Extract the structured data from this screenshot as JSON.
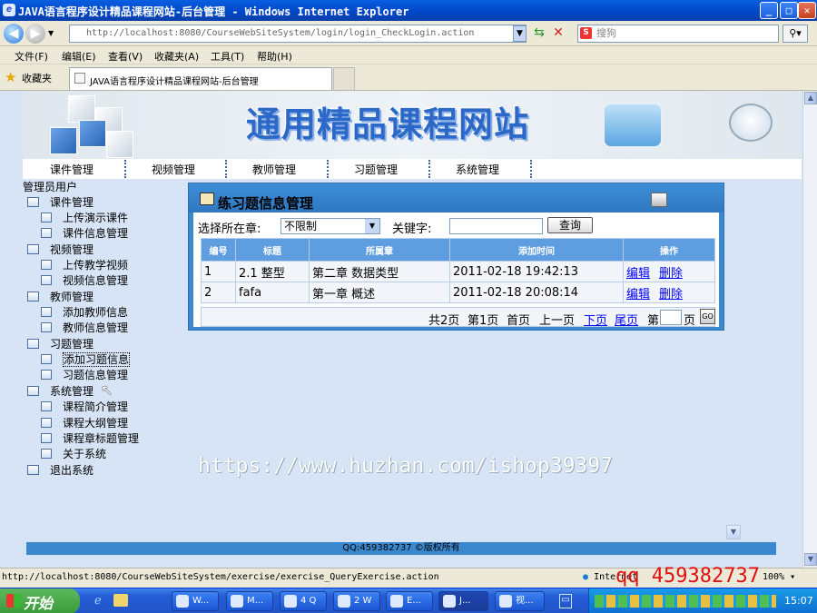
{
  "window": {
    "title": "JAVA语言程序设计精品课程网站-后台管理 - Windows Internet Explorer",
    "icon": "ie-icon",
    "address": "http://localhost:8080/CourseWebSiteSystem/login/login_CheckLogin.action",
    "search_placeholder": "搜狗"
  },
  "menu": [
    "文件(F)",
    "编辑(E)",
    "查看(V)",
    "收藏夹(A)",
    "工具(T)",
    "帮助(H)"
  ],
  "favorites": {
    "label": "收藏夹",
    "tab_title": "JAVA语言程序设计精品课程网站-后台管理"
  },
  "banner": {
    "title": "通用精品课程网站"
  },
  "nav": [
    "课件管理",
    "视频管理",
    "教师管理",
    "习题管理",
    "系统管理"
  ],
  "sidebar": {
    "caption": "管理员用户",
    "groups": [
      {
        "label": "课件管理",
        "items": [
          "上传演示课件",
          "课件信息管理"
        ]
      },
      {
        "label": "视频管理",
        "items": [
          "上传教学视频",
          "视频信息管理"
        ]
      },
      {
        "label": "教师管理",
        "items": [
          "添加教师信息",
          "教师信息管理"
        ]
      },
      {
        "label": "习题管理",
        "items": [
          "添加习题信息",
          "习题信息管理"
        ]
      },
      {
        "label": "系统管理",
        "items": [
          "课程简介管理",
          "课程大纲管理",
          "课程章标题管理",
          "关于系统"
        ]
      },
      {
        "label": "退出系统",
        "items": []
      }
    ]
  },
  "panel": {
    "title": "练习题信息管理",
    "filter_label": "选择所在章:",
    "chapter_value": "不限制",
    "keyword_label": "关键字:",
    "query_button": "查询",
    "columns": [
      "编号",
      "标题",
      "所属章",
      "添加时间",
      "操作"
    ],
    "rows": [
      {
        "id": "1",
        "title": "2.1 整型",
        "chapter": "第二章 数据类型",
        "time": "2011-02-18 19:42:13",
        "edit": "编辑",
        "del": "删除"
      },
      {
        "id": "2",
        "title": "fafa",
        "chapter": "第一章 概述",
        "time": "2011-02-18 20:08:14",
        "edit": "编辑",
        "del": "删除"
      }
    ],
    "pager": {
      "total": "共2页",
      "current": "第1页",
      "first": "首页",
      "prev": "上一页",
      "next": "下页",
      "last": "尾页",
      "goto_prefix": "第",
      "goto_suffix": "页",
      "go": "GO"
    }
  },
  "watermark": "https://www.huzhan.com/ishop39397",
  "footer": "QQ:459382737 ©版权所有",
  "statusbar": {
    "url": "http://localhost:8080/CourseWebSiteSystem/exercise/exercise_QueryExercise.action",
    "zone": "Internet",
    "overlay": "qq 459382737",
    "zoom": "100%"
  },
  "taskbar": {
    "start": "开始",
    "buttons": [
      "W...",
      "M...",
      "4 Q",
      "2 W",
      "E...",
      "J...",
      "视..."
    ],
    "clock": "15:07"
  }
}
